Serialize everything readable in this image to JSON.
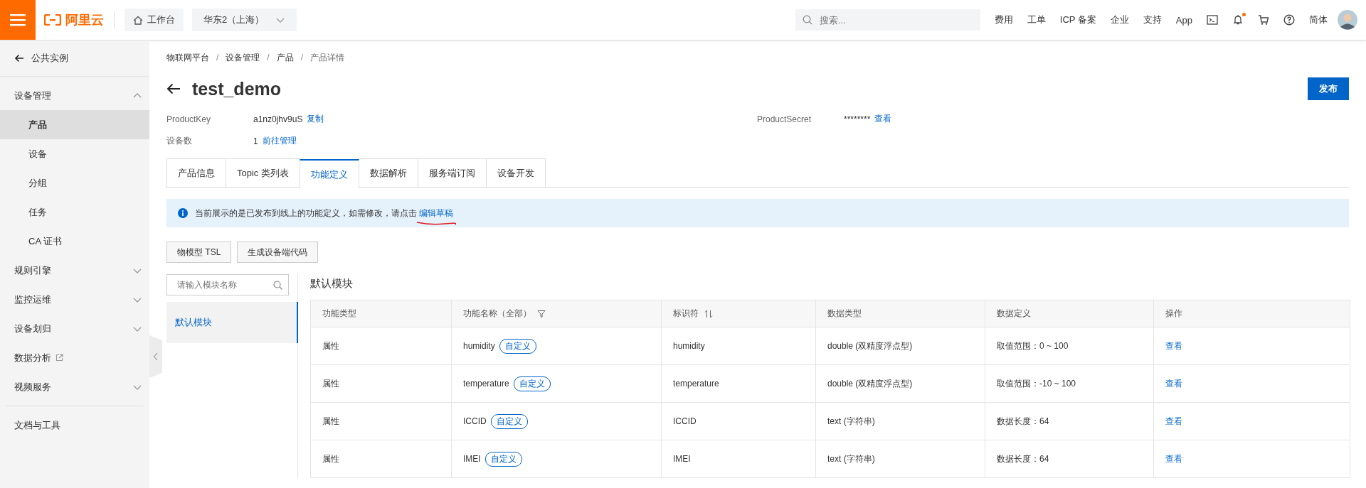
{
  "topbar": {
    "logo": "阿里云",
    "workbench": "工作台",
    "region": "华东2（上海）",
    "search": {
      "placeholder": "搜索..."
    },
    "links": [
      "费用",
      "工单",
      "ICP 备案",
      "企业",
      "支持",
      "App"
    ],
    "notification_dot": true,
    "language": "简体"
  },
  "sidebar": {
    "back": "公共实例",
    "items": [
      {
        "kind": "group",
        "label": "设备管理",
        "expanded": true,
        "children": [
          {
            "label": "产品",
            "selected": true
          },
          {
            "label": "设备",
            "selected": false
          },
          {
            "label": "分组",
            "selected": false
          },
          {
            "label": "任务",
            "selected": false
          },
          {
            "label": "CA 证书",
            "selected": false
          }
        ]
      },
      {
        "kind": "group",
        "label": "规则引擎",
        "expanded": false
      },
      {
        "kind": "group",
        "label": "监控运维",
        "expanded": false
      },
      {
        "kind": "group",
        "label": "设备划归",
        "expanded": false
      },
      {
        "kind": "external",
        "label": "数据分析"
      },
      {
        "kind": "group",
        "label": "视频服务",
        "expanded": false
      }
    ],
    "footer": "文档与工具"
  },
  "breadcrumb": {
    "separator": "/",
    "items": [
      "物联网平台",
      "设备管理",
      "产品",
      "产品详情"
    ]
  },
  "title": "test_demo",
  "publish_button": "发布",
  "fields": [
    {
      "label": "ProductKey",
      "value": "a1nz0jhv9uS",
      "action": "复制"
    },
    {
      "label": "ProductSecret",
      "value": "********",
      "action": "查看"
    },
    {
      "label": "设备数",
      "value": "1",
      "action": "前往管理"
    }
  ],
  "tabs": [
    {
      "label": "产品信息",
      "selected": false
    },
    {
      "label": "Topic 类列表",
      "selected": false
    },
    {
      "label": "功能定义",
      "selected": true
    },
    {
      "label": "数据解析",
      "selected": false
    },
    {
      "label": "服务端订阅",
      "selected": false
    },
    {
      "label": "设备开发",
      "selected": false
    }
  ],
  "notice": {
    "text": "当前展示的是已发布到线上的功能定义，如需修改，请点击",
    "link": "编辑草稿"
  },
  "tool_buttons": [
    "物模型 TSL",
    "生成设备端代码"
  ],
  "module_search": {
    "placeholder": "请输入模块名称"
  },
  "modules": [
    {
      "label": "默认模块",
      "selected": true
    }
  ],
  "module_title": "默认模块",
  "table": {
    "columns": [
      {
        "label": "功能类型",
        "kind": "plain"
      },
      {
        "label": "功能名称（全部）",
        "kind": "filter"
      },
      {
        "label": "标识符",
        "kind": "sort"
      },
      {
        "label": "数据类型",
        "kind": "plain"
      },
      {
        "label": "数据定义",
        "kind": "plain"
      },
      {
        "label": "操作",
        "kind": "plain"
      }
    ],
    "rows": [
      {
        "type": "属性",
        "name": "humidity",
        "tag": "自定义",
        "identifier": "humidity",
        "data_type": "double (双精度浮点型)",
        "definition": "取值范围：0 ~ 100",
        "action": "查看"
      },
      {
        "type": "属性",
        "name": "temperature",
        "tag": "自定义",
        "identifier": "temperature",
        "data_type": "double (双精度浮点型)",
        "definition": "取值范围：-10 ~ 100",
        "action": "查看"
      },
      {
        "type": "属性",
        "name": "ICCID",
        "tag": "自定义",
        "identifier": "ICCID",
        "data_type": "text (字符串)",
        "definition": "数据长度：64",
        "action": "查看"
      },
      {
        "type": "属性",
        "name": "IMEI",
        "tag": "自定义",
        "identifier": "IMEI",
        "data_type": "text (字符串)",
        "definition": "数据长度：64",
        "action": "查看"
      }
    ]
  }
}
